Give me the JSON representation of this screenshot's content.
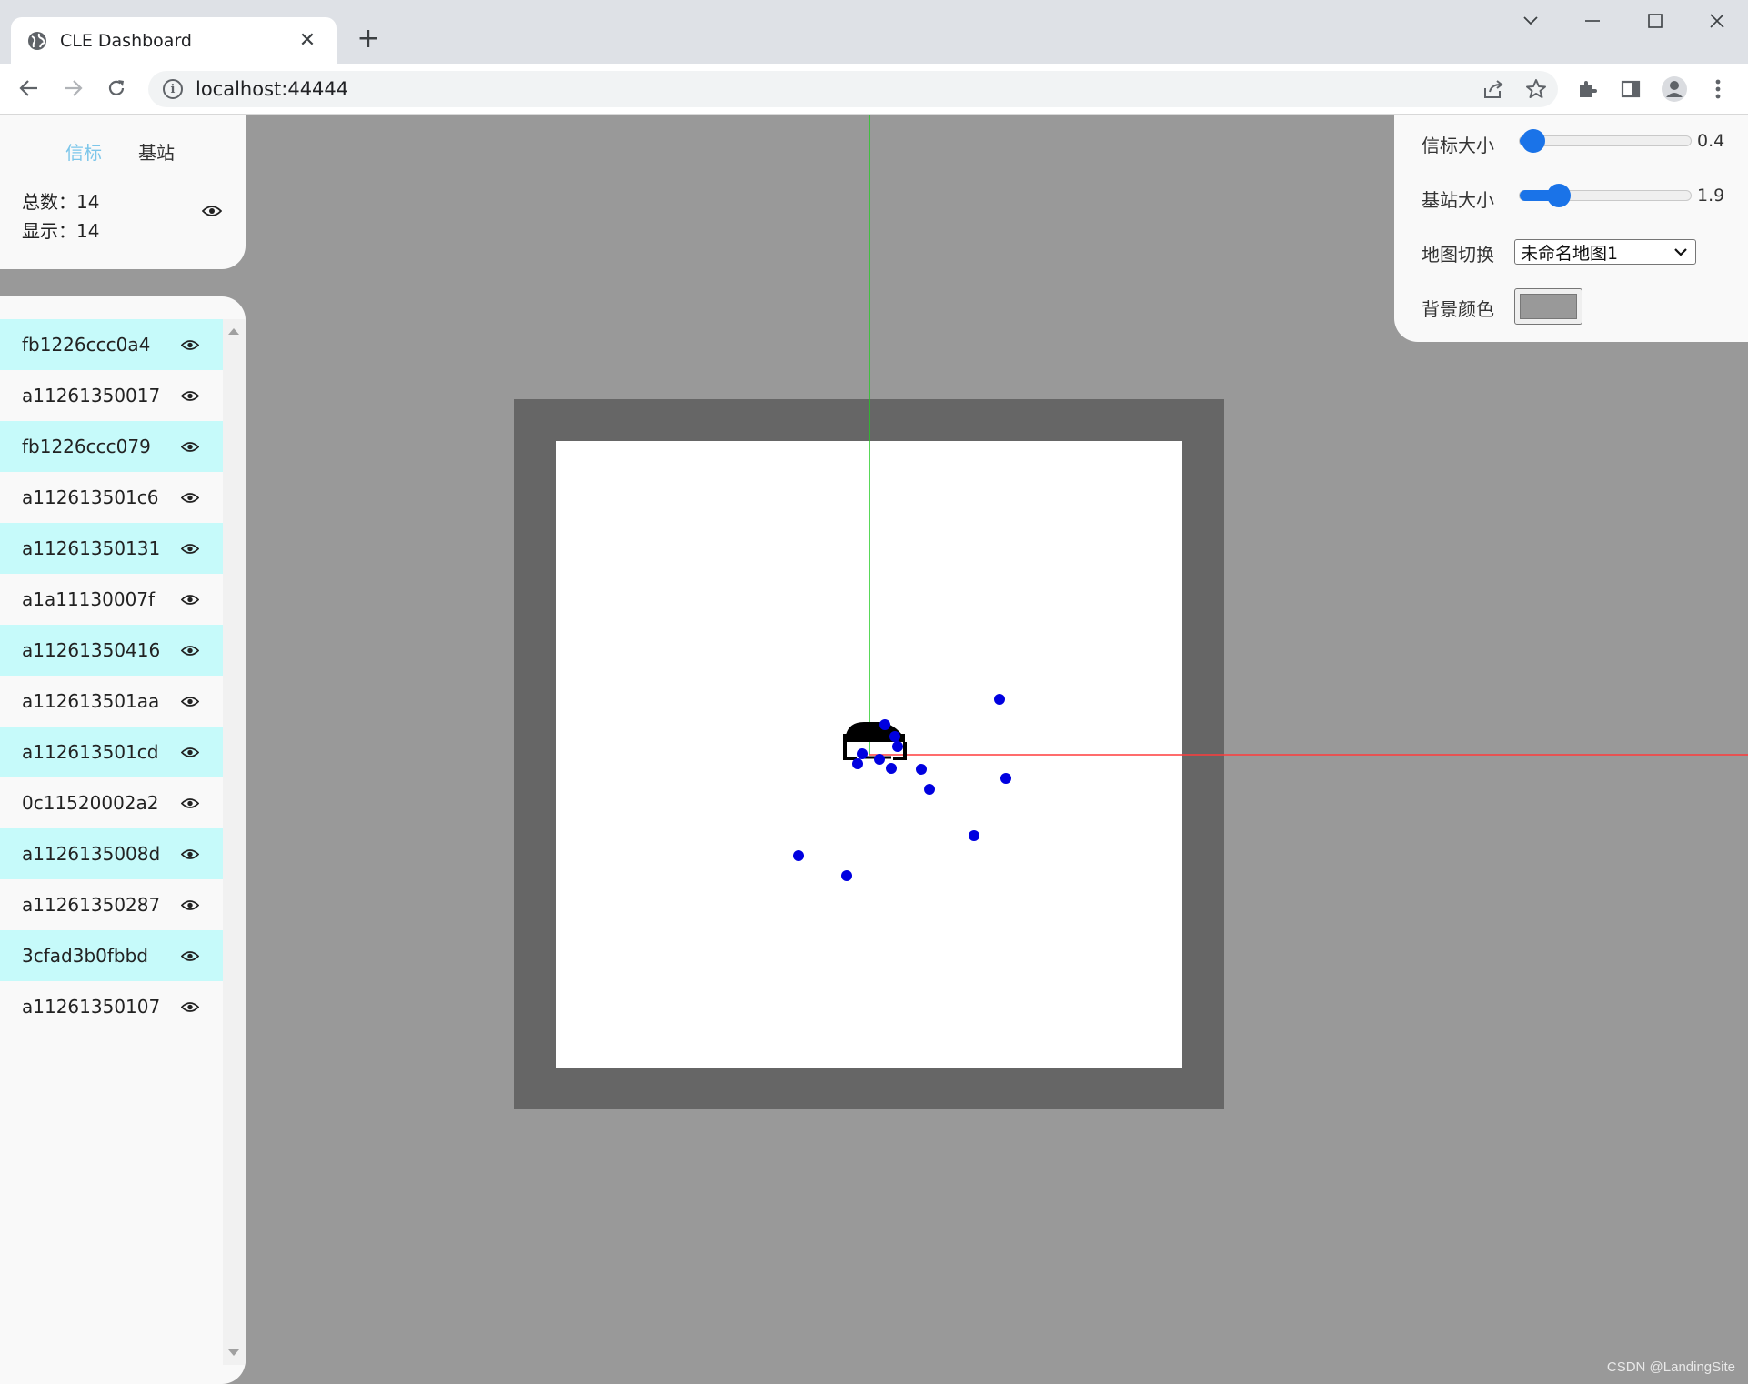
{
  "browser": {
    "tab_title": "CLE Dashboard",
    "url": "localhost:44444"
  },
  "info_panel": {
    "tabs": [
      {
        "label": "信标",
        "active": true
      },
      {
        "label": "基站",
        "active": false
      }
    ],
    "total_label": "总数：",
    "total_value": "14",
    "shown_label": "显示：",
    "shown_value": "14"
  },
  "beacons": [
    "fb1226ccc0a4",
    "a11261350017",
    "fb1226ccc079",
    "a112613501c6",
    "a11261350131",
    "a1a11130007f",
    "a11261350416",
    "a112613501aa",
    "a112613501cd",
    "0c11520002a2",
    "a1126135008d",
    "a11261350287",
    "3cfad3b0fbbd",
    "a11261350107"
  ],
  "controls": {
    "beacon_size": {
      "label": "信标大小",
      "value": "0.4",
      "fraction": 0.08
    },
    "station_size": {
      "label": "基站大小",
      "value": "1.9",
      "fraction": 0.23
    },
    "map_switch": {
      "label": "地图切换",
      "selected": "未命名地图1"
    },
    "background_color": {
      "label": "背景颜色",
      "value": "#999999"
    }
  },
  "colors": {
    "accent": "#1a73e8",
    "active_tab": "#7cc6ea",
    "row_highlight": "#c6fafa",
    "beacon_dot": "#0000e0",
    "x_axis": "#ff3b3b",
    "y_axis": "#22cc22",
    "map_border": "#666666"
  },
  "watermark": "CSDN @LandingSite"
}
